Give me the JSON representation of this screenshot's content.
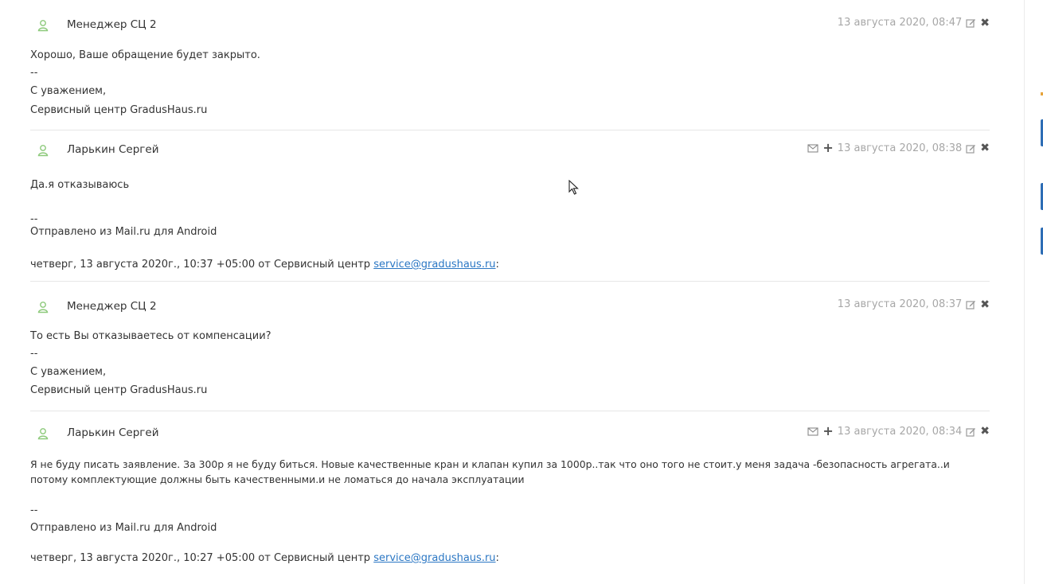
{
  "messages": [
    {
      "author": "Менеджер СЦ 2",
      "timestamp": "13 августа 2020, 08:47",
      "has_mail_icons": false,
      "body": [
        "Хорошо, Ваше обращение будет закрыто.",
        "--",
        "С уважением,",
        "Сервисный центр GradusHaus.ru"
      ]
    },
    {
      "author": "Ларькин Сергей",
      "timestamp": "13 августа 2020, 08:38",
      "has_mail_icons": true,
      "body": [
        "Да.я отказываюсь",
        "--",
        "Отправлено из Mail.ru для Android"
      ],
      "quote_prefix": "четверг, 13 августа 2020г., 10:37 +05:00 от Сервисный центр ",
      "quote_email": "service@gradushaus.ru",
      "quote_suffix": ":"
    },
    {
      "author": "Менеджер СЦ 2",
      "timestamp": "13 августа 2020, 08:37",
      "has_mail_icons": false,
      "body": [
        "То есть Вы отказываетесь от компенсации?",
        "--",
        "С уважением,",
        "Сервисный центр GradusHaus.ru"
      ]
    },
    {
      "author": "Ларькин Сергей",
      "timestamp": "13 августа 2020, 08:34",
      "has_mail_icons": true,
      "body": [
        "Я не буду писать заявление. За 300р я не буду биться. Новые качественные кран и клапан купил за 1000р..так что оно того не стоит.у меня задача -безопасность агрегата..и потому комплектующие должны быть качественными.и не ломаться до начала эксплуатации",
        "--",
        "Отправлено из Mail.ru для Android"
      ],
      "quote_prefix": "четверг, 13 августа 2020г., 10:27 +05:00 от Сервисный центр ",
      "quote_email": "service@gradushaus.ru",
      "quote_suffix": ":"
    }
  ],
  "icons": {
    "user": "user-icon",
    "edit": "edit-icon",
    "delete": "delete-icon",
    "mail": "envelope-icon",
    "add": "plus-icon"
  },
  "colors": {
    "user_icon": "#8cc97a",
    "link": "#2b77c4",
    "timestamp": "#a7a7a7",
    "sidebar_button": "#2d6db5"
  }
}
